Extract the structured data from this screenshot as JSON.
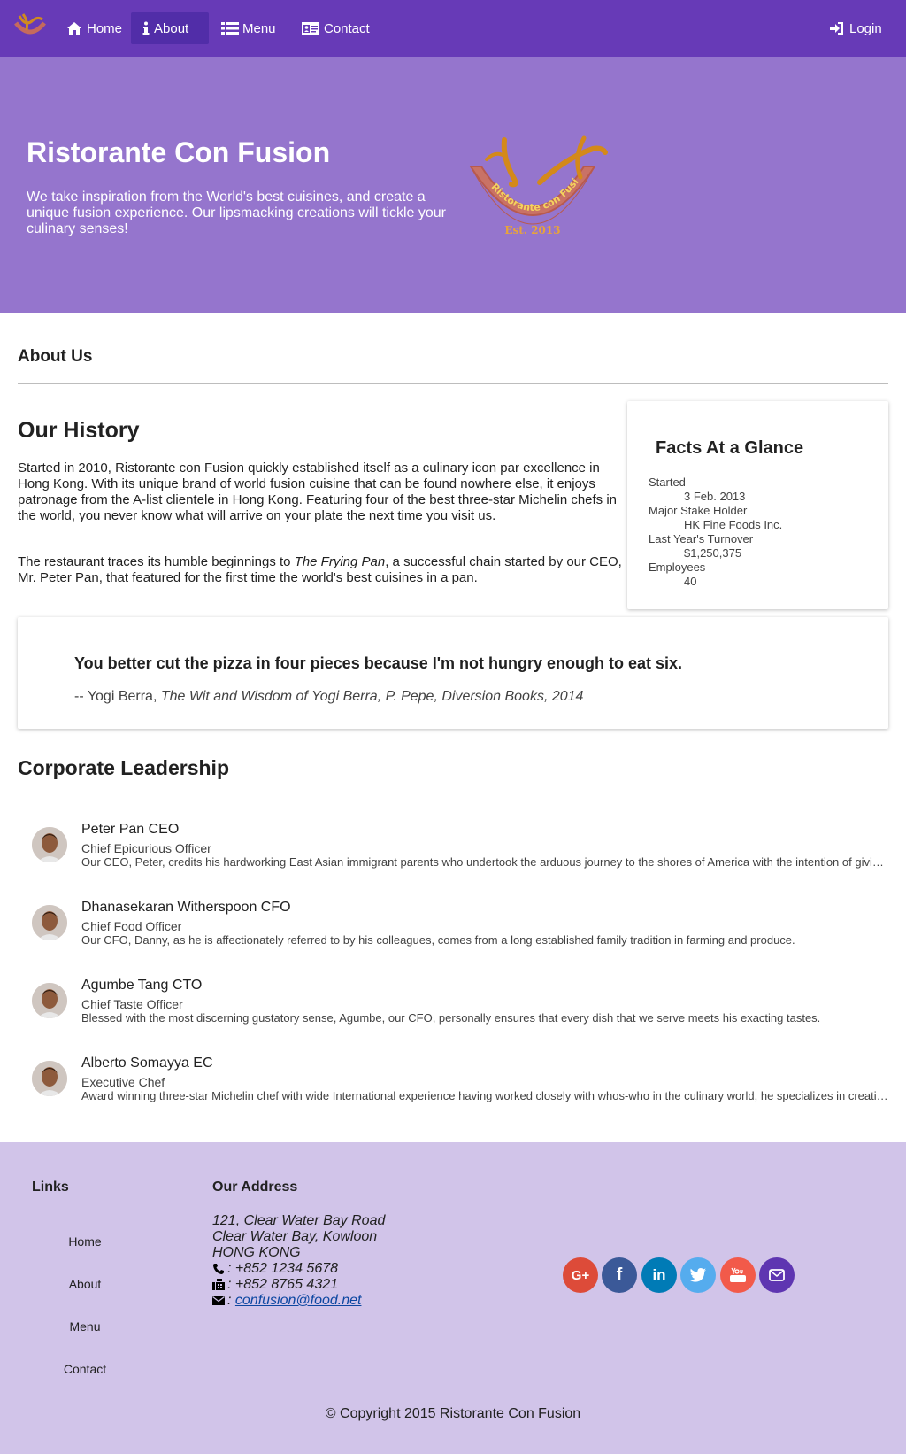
{
  "nav": {
    "items": [
      {
        "label": "Home",
        "icon": "home-icon"
      },
      {
        "label": "About",
        "icon": "info-icon"
      },
      {
        "label": "Menu",
        "icon": "list-icon"
      },
      {
        "label": "Contact",
        "icon": "address-card-icon"
      }
    ],
    "login": "Login",
    "active_color": "#512da8",
    "bar_color": "#673ab7"
  },
  "jumbotron": {
    "title": "Ristorante Con Fusion",
    "text": "We take inspiration from the World's best cuisines, and create a unique fusion experience. Our lipsmacking creations will tickle your culinary senses!",
    "logo_text": "Ristorante con Fusion",
    "logo_est": "Est. 2013"
  },
  "about": {
    "page_title": "About Us",
    "history_title": "Our History",
    "history_p1": "Started in 2010, Ristorante con Fusion quickly established itself as a culinary icon par excellence in Hong Kong. With its unique brand of world fusion cuisine that can be found nowhere else, it enjoys patronage from the A-list clientele in Hong Kong. Featuring four of the best three-star Michelin chefs in the world, you never know what will arrive on your plate the next time you visit us.",
    "history_p2_before": "The restaurant traces its humble beginnings to ",
    "history_p2_em": "The Frying Pan",
    "history_p2_after": ", a successful chain started by our CEO, Mr. Peter Pan, that featured for the first time the world's best cuisines in a pan."
  },
  "facts": {
    "title": "Facts At a Glance",
    "items": [
      {
        "term": "Started",
        "value": "3 Feb. 2013"
      },
      {
        "term": "Major Stake Holder",
        "value": "HK Fine Foods Inc."
      },
      {
        "term": "Last Year's Turnover",
        "value": "$1,250,375"
      },
      {
        "term": "Employees",
        "value": "40"
      }
    ]
  },
  "quote": {
    "text": "You better cut the pizza in four pieces because I'm not hungry enough to eat six.",
    "author": "-- Yogi Berra, ",
    "source": "The Wit and Wisdom of Yogi Berra, P. Pepe, Diversion Books, 2014"
  },
  "leadership": {
    "title": "Corporate Leadership",
    "leaders": [
      {
        "name": "Peter Pan CEO",
        "role": "Chief Epicurious Officer",
        "desc": "Our CEO, Peter, credits his hardworking East Asian immigrant parents who undertook the arduous journey to the shores of America with the intention of giving their children the best future."
      },
      {
        "name": "Dhanasekaran Witherspoon CFO",
        "role": "Chief Food Officer",
        "desc": "Our CFO, Danny, as he is affectionately referred to by his colleagues, comes from a long established family tradition in farming and produce."
      },
      {
        "name": "Agumbe Tang CTO",
        "role": "Chief Taste Officer",
        "desc": "Blessed with the most discerning gustatory sense, Agumbe, our CFO, personally ensures that every dish that we serve meets his exacting tastes."
      },
      {
        "name": "Alberto Somayya EC",
        "role": "Executive Chef",
        "desc": "Award winning three-star Michelin chef with wide International experience having worked closely with whos-who in the culinary world, he specializes in creating mouthwatering Indo-Italian fusion experiences."
      }
    ]
  },
  "footer": {
    "links_title": "Links",
    "links": [
      "Home",
      "About",
      "Menu",
      "Contact"
    ],
    "address_title": "Our Address",
    "address_lines": [
      "121, Clear Water Bay Road",
      "Clear Water Bay, Kowloon",
      "HONG KONG"
    ],
    "phone": ": +852 1234 5678",
    "fax": ": +852 8765 4321",
    "email": "confusion@food.net",
    "social": [
      {
        "name": "google-plus-icon",
        "color": "#dd4b39"
      },
      {
        "name": "facebook-icon",
        "color": "#3b5998"
      },
      {
        "name": "linkedin-icon",
        "color": "#007bb6"
      },
      {
        "name": "twitter-icon",
        "color": "#55acee"
      },
      {
        "name": "youtube-icon",
        "color": "#f25a4a"
      },
      {
        "name": "mail-icon",
        "color": "#5e35b1"
      }
    ],
    "copyright": "© Copyright 2015 Ristorante Con Fusion"
  }
}
